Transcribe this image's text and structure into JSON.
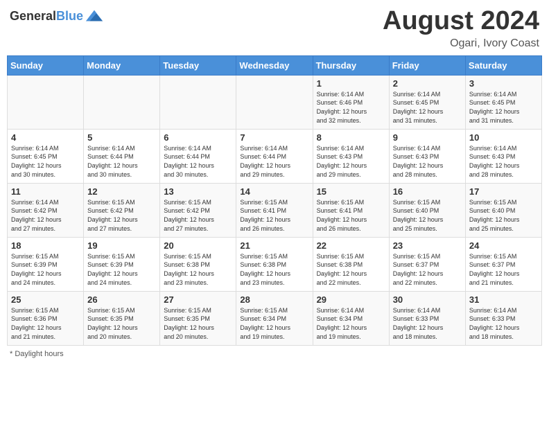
{
  "header": {
    "logo_line1": "General",
    "logo_line2": "Blue",
    "month_title": "August 2024",
    "location": "Ogari, Ivory Coast"
  },
  "days_of_week": [
    "Sunday",
    "Monday",
    "Tuesday",
    "Wednesday",
    "Thursday",
    "Friday",
    "Saturday"
  ],
  "footer": {
    "note": "Daylight hours"
  },
  "weeks": [
    {
      "days": [
        {
          "num": "",
          "info": ""
        },
        {
          "num": "",
          "info": ""
        },
        {
          "num": "",
          "info": ""
        },
        {
          "num": "",
          "info": ""
        },
        {
          "num": "1",
          "info": "Sunrise: 6:14 AM\nSunset: 6:46 PM\nDaylight: 12 hours\nand 32 minutes."
        },
        {
          "num": "2",
          "info": "Sunrise: 6:14 AM\nSunset: 6:45 PM\nDaylight: 12 hours\nand 31 minutes."
        },
        {
          "num": "3",
          "info": "Sunrise: 6:14 AM\nSunset: 6:45 PM\nDaylight: 12 hours\nand 31 minutes."
        }
      ]
    },
    {
      "days": [
        {
          "num": "4",
          "info": "Sunrise: 6:14 AM\nSunset: 6:45 PM\nDaylight: 12 hours\nand 30 minutes."
        },
        {
          "num": "5",
          "info": "Sunrise: 6:14 AM\nSunset: 6:44 PM\nDaylight: 12 hours\nand 30 minutes."
        },
        {
          "num": "6",
          "info": "Sunrise: 6:14 AM\nSunset: 6:44 PM\nDaylight: 12 hours\nand 30 minutes."
        },
        {
          "num": "7",
          "info": "Sunrise: 6:14 AM\nSunset: 6:44 PM\nDaylight: 12 hours\nand 29 minutes."
        },
        {
          "num": "8",
          "info": "Sunrise: 6:14 AM\nSunset: 6:43 PM\nDaylight: 12 hours\nand 29 minutes."
        },
        {
          "num": "9",
          "info": "Sunrise: 6:14 AM\nSunset: 6:43 PM\nDaylight: 12 hours\nand 28 minutes."
        },
        {
          "num": "10",
          "info": "Sunrise: 6:14 AM\nSunset: 6:43 PM\nDaylight: 12 hours\nand 28 minutes."
        }
      ]
    },
    {
      "days": [
        {
          "num": "11",
          "info": "Sunrise: 6:14 AM\nSunset: 6:42 PM\nDaylight: 12 hours\nand 27 minutes."
        },
        {
          "num": "12",
          "info": "Sunrise: 6:15 AM\nSunset: 6:42 PM\nDaylight: 12 hours\nand 27 minutes."
        },
        {
          "num": "13",
          "info": "Sunrise: 6:15 AM\nSunset: 6:42 PM\nDaylight: 12 hours\nand 27 minutes."
        },
        {
          "num": "14",
          "info": "Sunrise: 6:15 AM\nSunset: 6:41 PM\nDaylight: 12 hours\nand 26 minutes."
        },
        {
          "num": "15",
          "info": "Sunrise: 6:15 AM\nSunset: 6:41 PM\nDaylight: 12 hours\nand 26 minutes."
        },
        {
          "num": "16",
          "info": "Sunrise: 6:15 AM\nSunset: 6:40 PM\nDaylight: 12 hours\nand 25 minutes."
        },
        {
          "num": "17",
          "info": "Sunrise: 6:15 AM\nSunset: 6:40 PM\nDaylight: 12 hours\nand 25 minutes."
        }
      ]
    },
    {
      "days": [
        {
          "num": "18",
          "info": "Sunrise: 6:15 AM\nSunset: 6:39 PM\nDaylight: 12 hours\nand 24 minutes."
        },
        {
          "num": "19",
          "info": "Sunrise: 6:15 AM\nSunset: 6:39 PM\nDaylight: 12 hours\nand 24 minutes."
        },
        {
          "num": "20",
          "info": "Sunrise: 6:15 AM\nSunset: 6:38 PM\nDaylight: 12 hours\nand 23 minutes."
        },
        {
          "num": "21",
          "info": "Sunrise: 6:15 AM\nSunset: 6:38 PM\nDaylight: 12 hours\nand 23 minutes."
        },
        {
          "num": "22",
          "info": "Sunrise: 6:15 AM\nSunset: 6:38 PM\nDaylight: 12 hours\nand 22 minutes."
        },
        {
          "num": "23",
          "info": "Sunrise: 6:15 AM\nSunset: 6:37 PM\nDaylight: 12 hours\nand 22 minutes."
        },
        {
          "num": "24",
          "info": "Sunrise: 6:15 AM\nSunset: 6:37 PM\nDaylight: 12 hours\nand 21 minutes."
        }
      ]
    },
    {
      "days": [
        {
          "num": "25",
          "info": "Sunrise: 6:15 AM\nSunset: 6:36 PM\nDaylight: 12 hours\nand 21 minutes."
        },
        {
          "num": "26",
          "info": "Sunrise: 6:15 AM\nSunset: 6:35 PM\nDaylight: 12 hours\nand 20 minutes."
        },
        {
          "num": "27",
          "info": "Sunrise: 6:15 AM\nSunset: 6:35 PM\nDaylight: 12 hours\nand 20 minutes."
        },
        {
          "num": "28",
          "info": "Sunrise: 6:15 AM\nSunset: 6:34 PM\nDaylight: 12 hours\nand 19 minutes."
        },
        {
          "num": "29",
          "info": "Sunrise: 6:14 AM\nSunset: 6:34 PM\nDaylight: 12 hours\nand 19 minutes."
        },
        {
          "num": "30",
          "info": "Sunrise: 6:14 AM\nSunset: 6:33 PM\nDaylight: 12 hours\nand 18 minutes."
        },
        {
          "num": "31",
          "info": "Sunrise: 6:14 AM\nSunset: 6:33 PM\nDaylight: 12 hours\nand 18 minutes."
        }
      ]
    }
  ]
}
